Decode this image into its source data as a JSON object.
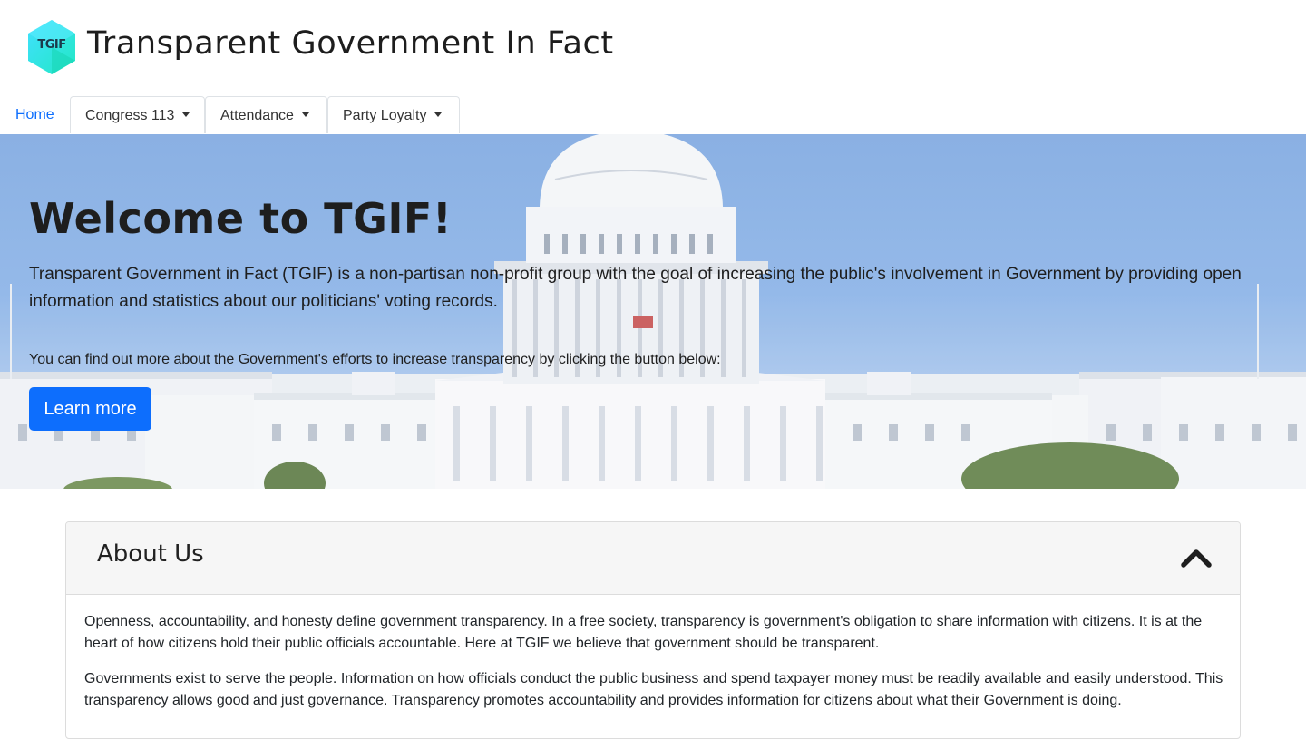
{
  "header": {
    "logo_text": "TGIF",
    "title": "Transparent Government In Fact"
  },
  "nav": {
    "home": "Home",
    "dropdowns": [
      {
        "label": "Congress 113"
      },
      {
        "label": "Attendance"
      },
      {
        "label": "Party Loyalty"
      }
    ]
  },
  "hero": {
    "title": "Welcome to TGIF!",
    "lead": "Transparent Government in Fact (TGIF) is a non-partisan non-profit group with the goal of increasing the public's involvement in Government by providing open information and statistics about our politicians' voting records.",
    "sub": "You can find out more about the Government's efforts to increase transparency by clicking the button below:",
    "button": "Learn more"
  },
  "about": {
    "title": "About Us",
    "paragraphs": [
      "Openness, accountability, and honesty define government transparency. In a free society, transparency is government's obligation to share information with citizens. It is at the heart of how citizens hold their public officials accountable. Here at TGIF we believe that government should be transparent.",
      "Governments exist to serve the people. Information on how officials conduct the public business and spend taxpayer money must be readily available and easily understood. This transparency allows good and just governance. Transparency promotes accountability and provides information for citizens about what their Government is doing."
    ]
  },
  "colors": {
    "primary": "#0d6efd",
    "logo_teal": "#2ee6cf",
    "sky": "#7ba6e0"
  },
  "icons": {
    "collapse": "chevron-up-icon",
    "dropdown": "caret-down-icon"
  }
}
